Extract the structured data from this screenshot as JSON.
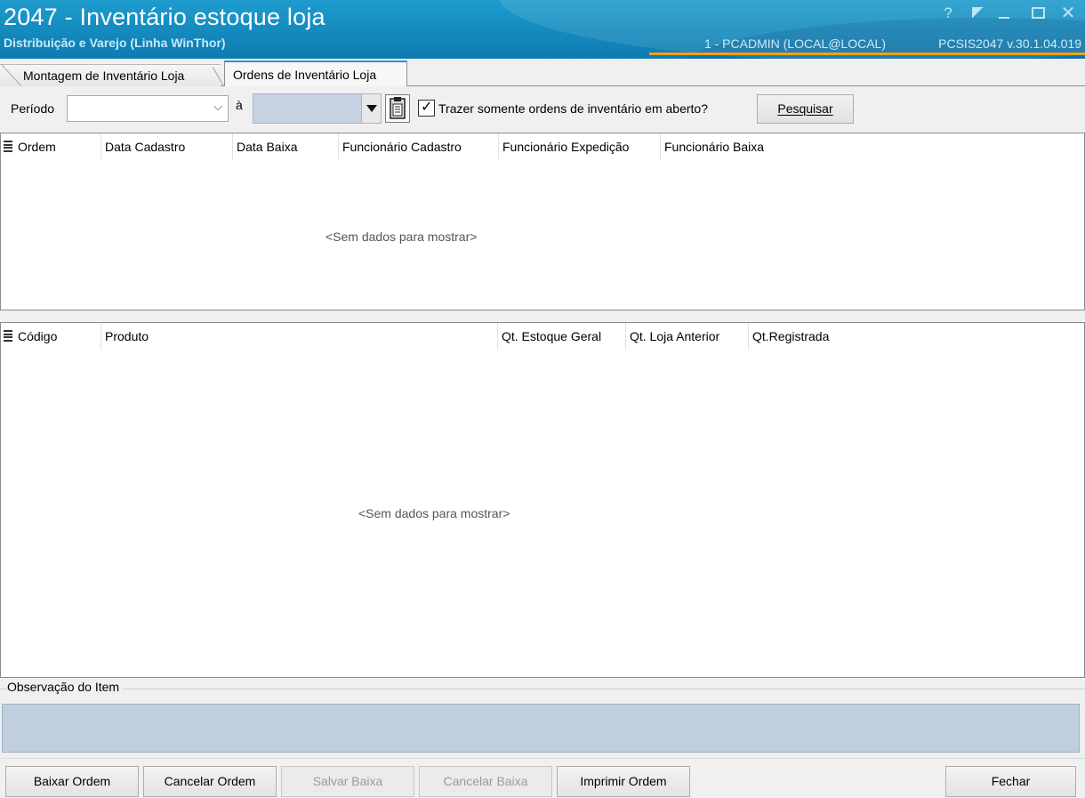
{
  "window": {
    "title": "2047 - Inventário estoque loja",
    "subtitle": "Distribuição e Varejo (Linha WinThor)",
    "user": "1 - PCADMIN (LOCAL@LOCAL)",
    "system": "PCSIS2047  v.30.1.04.019",
    "help_glyph": "?",
    "close_glyph": "✕"
  },
  "tabs": [
    {
      "label": "Montagem de Inventário Loja",
      "active": false
    },
    {
      "label": "Ordens de Inventário Loja",
      "active": true
    }
  ],
  "filter": {
    "periodo_label": "Período",
    "periodo_from_value": "",
    "a_label": "à",
    "periodo_to_value": "",
    "only_open_checked": true,
    "only_open_label": "Trazer somente ordens de inventário em aberto?",
    "search_button": "Pesquisar",
    "check_glyph": "✓",
    "chevron_glyph": "⌵"
  },
  "orders_grid": {
    "columns": [
      "Ordem",
      "Data Cadastro",
      "Data Baixa",
      "Funcionário Cadastro",
      "Funcionário Expedição",
      "Funcionário Baixa"
    ],
    "rows": [],
    "empty_text": "<Sem dados para mostrar>"
  },
  "items_grid": {
    "columns": [
      "Código",
      "Produto",
      "Qt. Estoque Geral",
      "Qt. Loja Anterior",
      "Qt.Registrada"
    ],
    "rows": [],
    "empty_text": "<Sem dados para mostrar>"
  },
  "observation": {
    "label": "Observação do Item",
    "value": ""
  },
  "buttons": {
    "baixar_ordem": {
      "label": "Baixar Ordem",
      "enabled": true
    },
    "cancelar_ordem": {
      "label": "Cancelar Ordem",
      "enabled": true
    },
    "salvar_baixa": {
      "label": "Salvar Baixa",
      "enabled": false
    },
    "cancelar_baixa": {
      "label": "Cancelar Baixa",
      "enabled": false
    },
    "imprimir_ordem": {
      "label": "Imprimir Ordem",
      "enabled": true
    },
    "fechar": {
      "label": "Fechar",
      "enabled": true
    }
  },
  "colors": {
    "titlebar": "#1489bd",
    "accent_line": "#f0a020",
    "input_focus_bg": "#c6d2e2"
  }
}
